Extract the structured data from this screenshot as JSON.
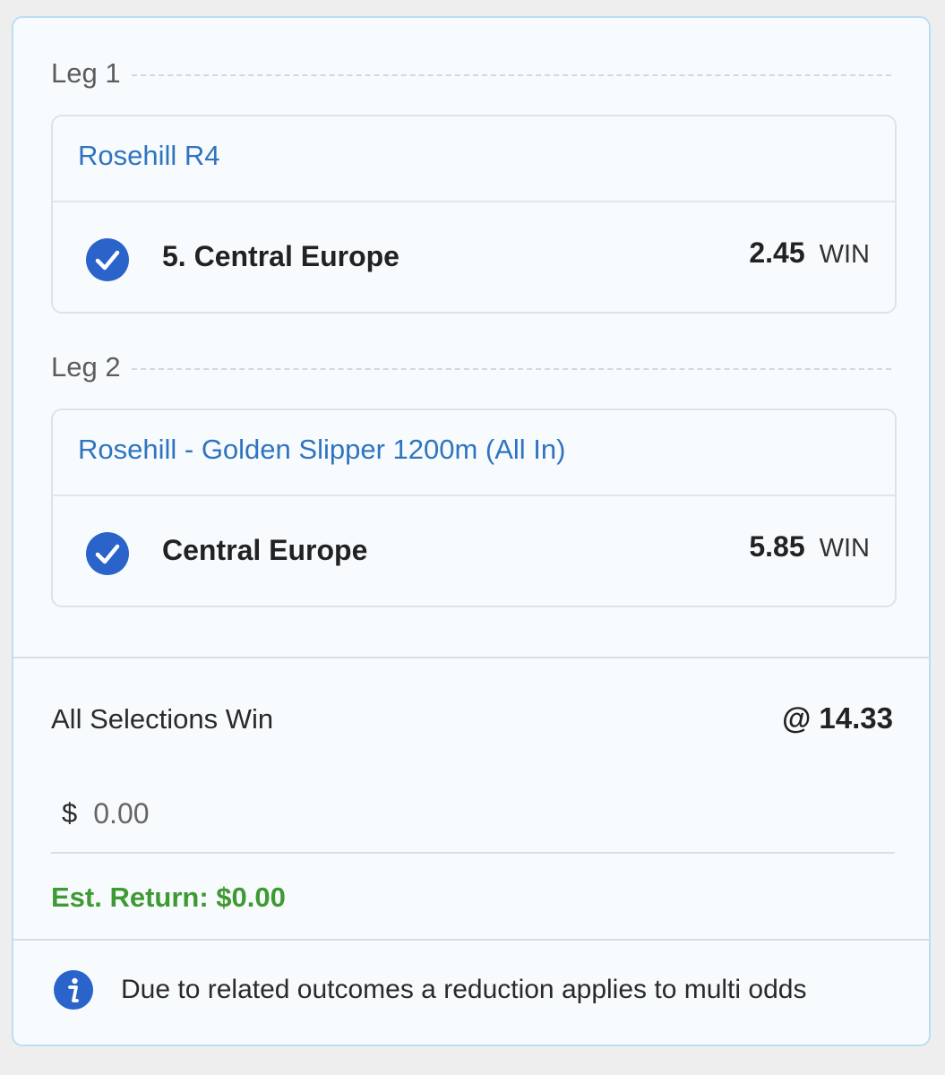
{
  "legs": [
    {
      "label": "Leg 1",
      "race": "Rosehill R4",
      "selection": "5. Central Europe",
      "odds": "2.45",
      "bet_type": "WIN"
    },
    {
      "label": "Leg 2",
      "race": "Rosehill - Golden Slipper 1200m (All In)",
      "selection": "Central Europe",
      "odds": "5.85",
      "bet_type": "WIN"
    }
  ],
  "multi": {
    "description": "All Selections Win",
    "odds": "@ 14.33",
    "currency": "$",
    "stake_placeholder": "0.00",
    "est_return": "Est. Return: $0.00"
  },
  "notice": {
    "icon": "info-icon",
    "text": "Due to related outcomes a reduction applies to multi odds"
  },
  "colors": {
    "accent_blue": "#2f74c0",
    "check_blue": "#2a63c9",
    "return_green": "#3e9a32",
    "card_border": "#b9dff3"
  }
}
